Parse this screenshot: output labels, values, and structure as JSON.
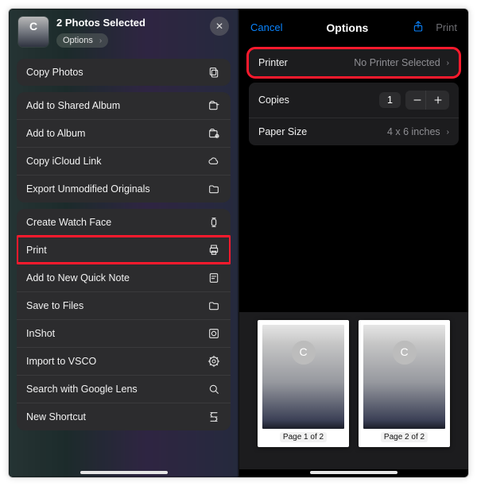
{
  "share": {
    "thumb_letter": "C",
    "title": "2 Photos Selected",
    "options_label": "Options",
    "close_glyph": "✕",
    "groups": [
      {
        "rows": [
          {
            "label": "Copy Photos",
            "icon": "copy"
          }
        ]
      },
      {
        "rows": [
          {
            "label": "Add to Shared Album",
            "icon": "shared-album"
          },
          {
            "label": "Add to Album",
            "icon": "album"
          },
          {
            "label": "Copy iCloud Link",
            "icon": "cloud"
          },
          {
            "label": "Export Unmodified Originals",
            "icon": "folder"
          }
        ]
      },
      {
        "rows": [
          {
            "label": "Create Watch Face",
            "icon": "watch"
          },
          {
            "label": "Print",
            "icon": "print",
            "highlight": true
          },
          {
            "label": "Add to New Quick Note",
            "icon": "note"
          },
          {
            "label": "Save to Files",
            "icon": "folder"
          },
          {
            "label": "InShot",
            "icon": "inshot"
          },
          {
            "label": "Import to VSCO",
            "icon": "vsco"
          },
          {
            "label": "Search with Google Lens",
            "icon": "search"
          },
          {
            "label": "New Shortcut",
            "icon": "shortcut"
          }
        ]
      }
    ]
  },
  "print": {
    "cancel": "Cancel",
    "title": "Options",
    "share_icon": "share",
    "print_label": "Print",
    "printer_row": {
      "label": "Printer",
      "value": "No Printer Selected"
    },
    "copies_row": {
      "label": "Copies",
      "value": "1"
    },
    "paper_row": {
      "label": "Paper Size",
      "value": "4 x 6 inches"
    },
    "pages": [
      {
        "letter": "C",
        "caption": "Page 1 of 2"
      },
      {
        "letter": "C",
        "caption": "Page 2 of 2"
      }
    ]
  }
}
